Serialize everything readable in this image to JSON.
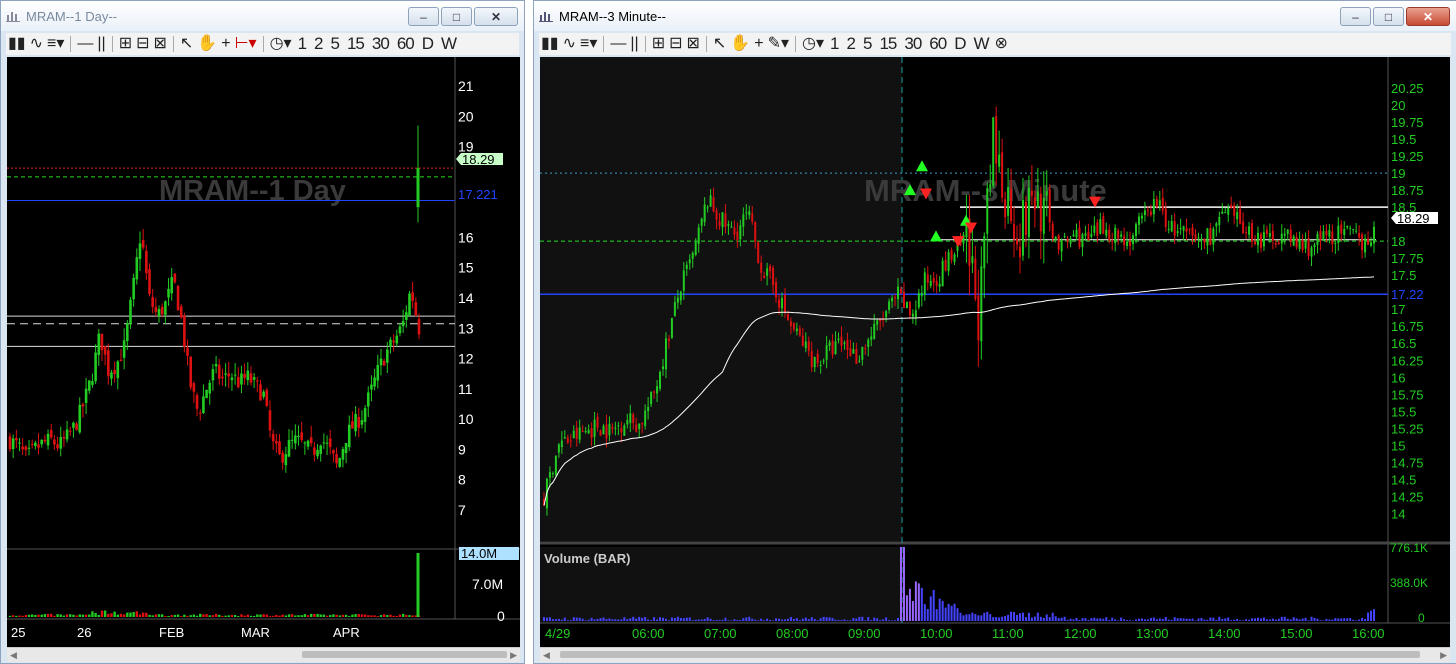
{
  "left_window": {
    "title": "MRAM--1 Day--",
    "watermark": "MRAM--1 Day",
    "toolbar": {
      "frames": [
        "1",
        "2",
        "5",
        "15",
        "30",
        "60",
        "D",
        "W"
      ]
    },
    "price_axis": [
      "21",
      "20",
      "19",
      "18",
      "17",
      "16",
      "15",
      "14",
      "13",
      "12",
      "11",
      "10",
      "9",
      "8",
      "7"
    ],
    "price_label": "18.29",
    "blue_line_label": "17.221",
    "volume_axis": [
      "14.0M",
      "7.0M",
      "0"
    ],
    "date_labels": [
      "25",
      "26",
      "FEB",
      "MAR",
      "APR"
    ]
  },
  "right_window": {
    "title": "MRAM--3 Minute--",
    "watermark": "MRAM--3 Minute",
    "toolbar": {
      "frames": [
        "1",
        "2",
        "5",
        "15",
        "30",
        "60",
        "D",
        "W"
      ]
    },
    "price_axis": [
      "20.25",
      "20",
      "19.75",
      "19.5",
      "19.25",
      "19",
      "18.75",
      "18.5",
      "18.25",
      "18",
      "17.75",
      "17.5",
      "17.25",
      "17",
      "16.75",
      "16.5",
      "16.25",
      "16",
      "15.75",
      "15.5",
      "15.25",
      "15",
      "14.75",
      "14.5",
      "14.25",
      "14"
    ],
    "price_label": "18.29",
    "blue_line_label": "17.22",
    "volume_title": "Volume (BAR)",
    "volume_axis": [
      "776.1K",
      "388.0K",
      "0"
    ],
    "time_labels": [
      "4/29",
      "06:00",
      "07:00",
      "08:00",
      "09:00",
      "10:00",
      "11:00",
      "12:00",
      "13:00",
      "14:00",
      "15:00",
      "16:00"
    ]
  },
  "colors": {
    "up": "#22cc22",
    "down": "#dd1111",
    "blue_line": "#2244ff",
    "axis_text": "#22cc22",
    "volume_bar": "#4444ff"
  },
  "chart_data": [
    {
      "type": "candlestick",
      "title": "MRAM--1 Day",
      "ylim": [
        6.5,
        21.5
      ],
      "levels": {
        "current": 18.29,
        "blue": 17.221,
        "green_dashed": 18.0,
        "red_dotted": 18.29,
        "white_lines": [
          13.4,
          13.15,
          12.4
        ]
      },
      "x": [
        "25",
        "26",
        "FEB",
        "MAR",
        "APR"
      ],
      "close_path": [
        9.3,
        9.1,
        8.7,
        9.0,
        9.2,
        9.3,
        9.1,
        9.4,
        9.8,
        10.5,
        11.4,
        12.8,
        11.6,
        11.8,
        12.4,
        14.2,
        16.2,
        14.0,
        13.4,
        13.8,
        14.6,
        13.2,
        11.2,
        10.2,
        11.0,
        11.6,
        11.3,
        11.5,
        11.2,
        11.4,
        11.1,
        10.8,
        9.2,
        8.7,
        9.1,
        9.3,
        9.1,
        8.9,
        9.4,
        9.0,
        8.4,
        9.4,
        9.8,
        10.1,
        10.8,
        11.6,
        12.2,
        12.6,
        13.1,
        14.3,
        13.0,
        18.29
      ],
      "volume_ylim": [
        0,
        14000000
      ],
      "volume_last": 14000000
    },
    {
      "type": "candlestick",
      "title": "MRAM--3 Minute",
      "ylim": [
        13.8,
        20.5
      ],
      "levels": {
        "current": 18.29,
        "blue": 17.22,
        "green_dashed": 18.0,
        "cyan_dotted": 19.0,
        "white_lines": [
          18.5
        ]
      },
      "x": [
        "4/29",
        "06:00",
        "07:00",
        "08:00",
        "09:00",
        "10:00",
        "11:00",
        "12:00",
        "13:00",
        "14:00",
        "15:00",
        "16:00"
      ],
      "close_path": [
        14.2,
        15.0,
        15.1,
        15.2,
        15.3,
        15.2,
        15.4,
        15.3,
        15.7,
        16.5,
        17.3,
        17.8,
        18.6,
        18.3,
        18.1,
        18.4,
        17.6,
        17.3,
        16.8,
        16.5,
        16.2,
        16.4,
        16.5,
        16.3,
        16.6,
        16.9,
        17.2,
        16.9,
        17.4,
        17.5,
        17.8,
        18.0,
        16.9,
        19.4,
        18.7,
        18.1,
        18.7,
        18.3,
        17.9,
        18.1,
        18.0,
        18.2,
        18.1,
        18.0,
        18.3,
        18.6,
        18.2,
        18.1,
        18.0,
        18.1,
        18.4,
        18.3,
        18.1,
        18.0,
        18.1,
        18.0,
        17.9,
        18.0,
        18.1,
        18.1,
        18.0,
        18.1,
        18.29
      ],
      "volume_ylim": [
        0,
        776100
      ],
      "volume_peak": 776100
    }
  ]
}
